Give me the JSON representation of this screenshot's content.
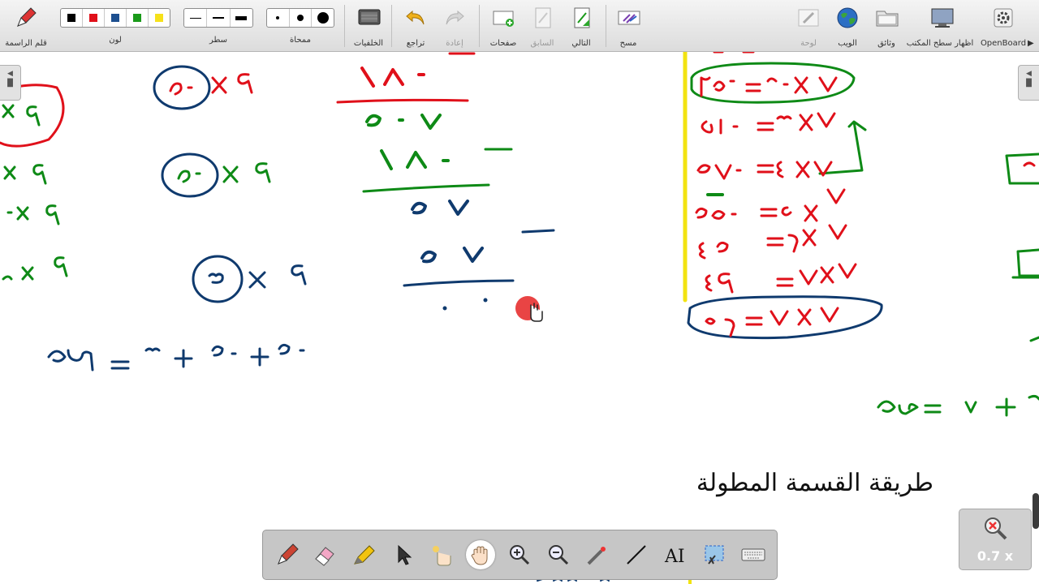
{
  "toolbar": {
    "pen": "قلم الراسمة",
    "color": "لون",
    "line": "سطر",
    "eraser": "ممحاة",
    "backgrounds": "الخلفيات",
    "undo": "تراجع",
    "redo": "إعادة",
    "pages": "صفحات",
    "previous": "السابق",
    "next": "التالي",
    "clear": "مسح",
    "board": "لوحة",
    "web": "الويب",
    "documents": "وثائق",
    "show_desktop": "اظهار سطح المكتب",
    "openboard": "OpenBoard"
  },
  "colors": {
    "black": "#000000",
    "red": "#e0101a",
    "blue": "#1d4f8f",
    "green": "#1a9a1a",
    "yellow": "#f6e11a",
    "ink_blue": "#0f3a6e",
    "ink_red": "#e0101a",
    "ink_green": "#0e8a16",
    "marker_yellow": "#f2e311"
  },
  "board": {
    "title": "طريقة القسمة المطولة"
  },
  "zoom": {
    "label": "0.7 x"
  },
  "icons": [
    "pen-icon",
    "eraser-icon",
    "highlighter-icon",
    "pointer-icon",
    "laser-icon",
    "hand-icon",
    "zoom-in-icon",
    "zoom-out-icon",
    "capture-icon",
    "line-icon",
    "text-icon",
    "select-icon",
    "keyboard-icon"
  ]
}
